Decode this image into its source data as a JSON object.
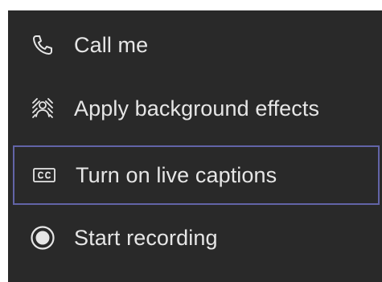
{
  "menu": {
    "items": [
      {
        "label": "Call me",
        "icon": "phone-icon"
      },
      {
        "label": "Apply background effects",
        "icon": "background-effects-icon"
      },
      {
        "label": "Turn on live captions",
        "icon": "closed-captions-icon",
        "focused": true
      },
      {
        "label": "Start recording",
        "icon": "record-icon"
      }
    ]
  },
  "colors": {
    "menu_background": "#292929",
    "text": "#e6e6e6",
    "focus_border": "#6264a7",
    "page_background": "#ffffff"
  }
}
